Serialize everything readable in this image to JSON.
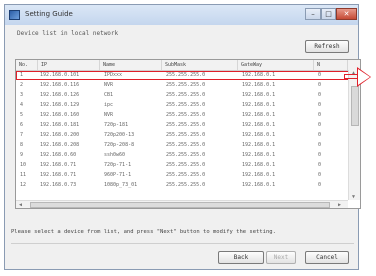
{
  "window": {
    "title": "Setting Guide",
    "minimize": "–",
    "maximize": "□",
    "close": "✕"
  },
  "subtitle": "Device list in local network",
  "refresh_label": "Refresh",
  "table": {
    "columns": [
      "No.",
      "IP",
      "Name",
      "SubMask",
      "GateWay",
      "N"
    ],
    "rows": [
      [
        "1",
        "192.168.0.101",
        "IPDxxx",
        "255.255.255.0",
        "192.168.0.1",
        "0"
      ],
      [
        "2",
        "192.168.0.116",
        "NVR",
        "255.255.255.0",
        "192.168.0.1",
        "0"
      ],
      [
        "3",
        "192.168.0.126",
        "CB1",
        "255.255.255.0",
        "192.168.0.1",
        "0"
      ],
      [
        "4",
        "192.168.0.129",
        "ipc",
        "255.255.255.0",
        "192.168.0.1",
        "0"
      ],
      [
        "5",
        "192.168.0.160",
        "NVR",
        "255.255.255.0",
        "192.168.0.1",
        "0"
      ],
      [
        "6",
        "192.168.0.181",
        "720p-181",
        "255.255.255.0",
        "192.168.0.1",
        "0"
      ],
      [
        "7",
        "192.168.0.200",
        "720p200-13",
        "255.255.255.0",
        "192.168.0.1",
        "0"
      ],
      [
        "8",
        "192.168.0.208",
        "720p-208-8",
        "255.255.255.0",
        "192.168.0.1",
        "0"
      ],
      [
        "9",
        "192.168.0.60",
        "ssh0w60",
        "255.255.255.0",
        "192.168.0.1",
        "0"
      ],
      [
        "10",
        "192.168.0.71",
        "720p-71-1",
        "255.255.255.0",
        "192.168.0.1",
        "0"
      ],
      [
        "11",
        "192.168.0.71",
        "960P-71-1",
        "255.255.255.0",
        "192.168.0.1",
        "0"
      ],
      [
        "12",
        "192.168.0.73",
        "1080p_73_01",
        "255.255.255.0",
        "192.168.0.1",
        "0"
      ]
    ]
  },
  "instruction": "Please select a device from list, and press \"Next\" button to modify the setting.",
  "buttons": {
    "back": "Back",
    "next": "Next",
    "cancel": "Cancel"
  }
}
